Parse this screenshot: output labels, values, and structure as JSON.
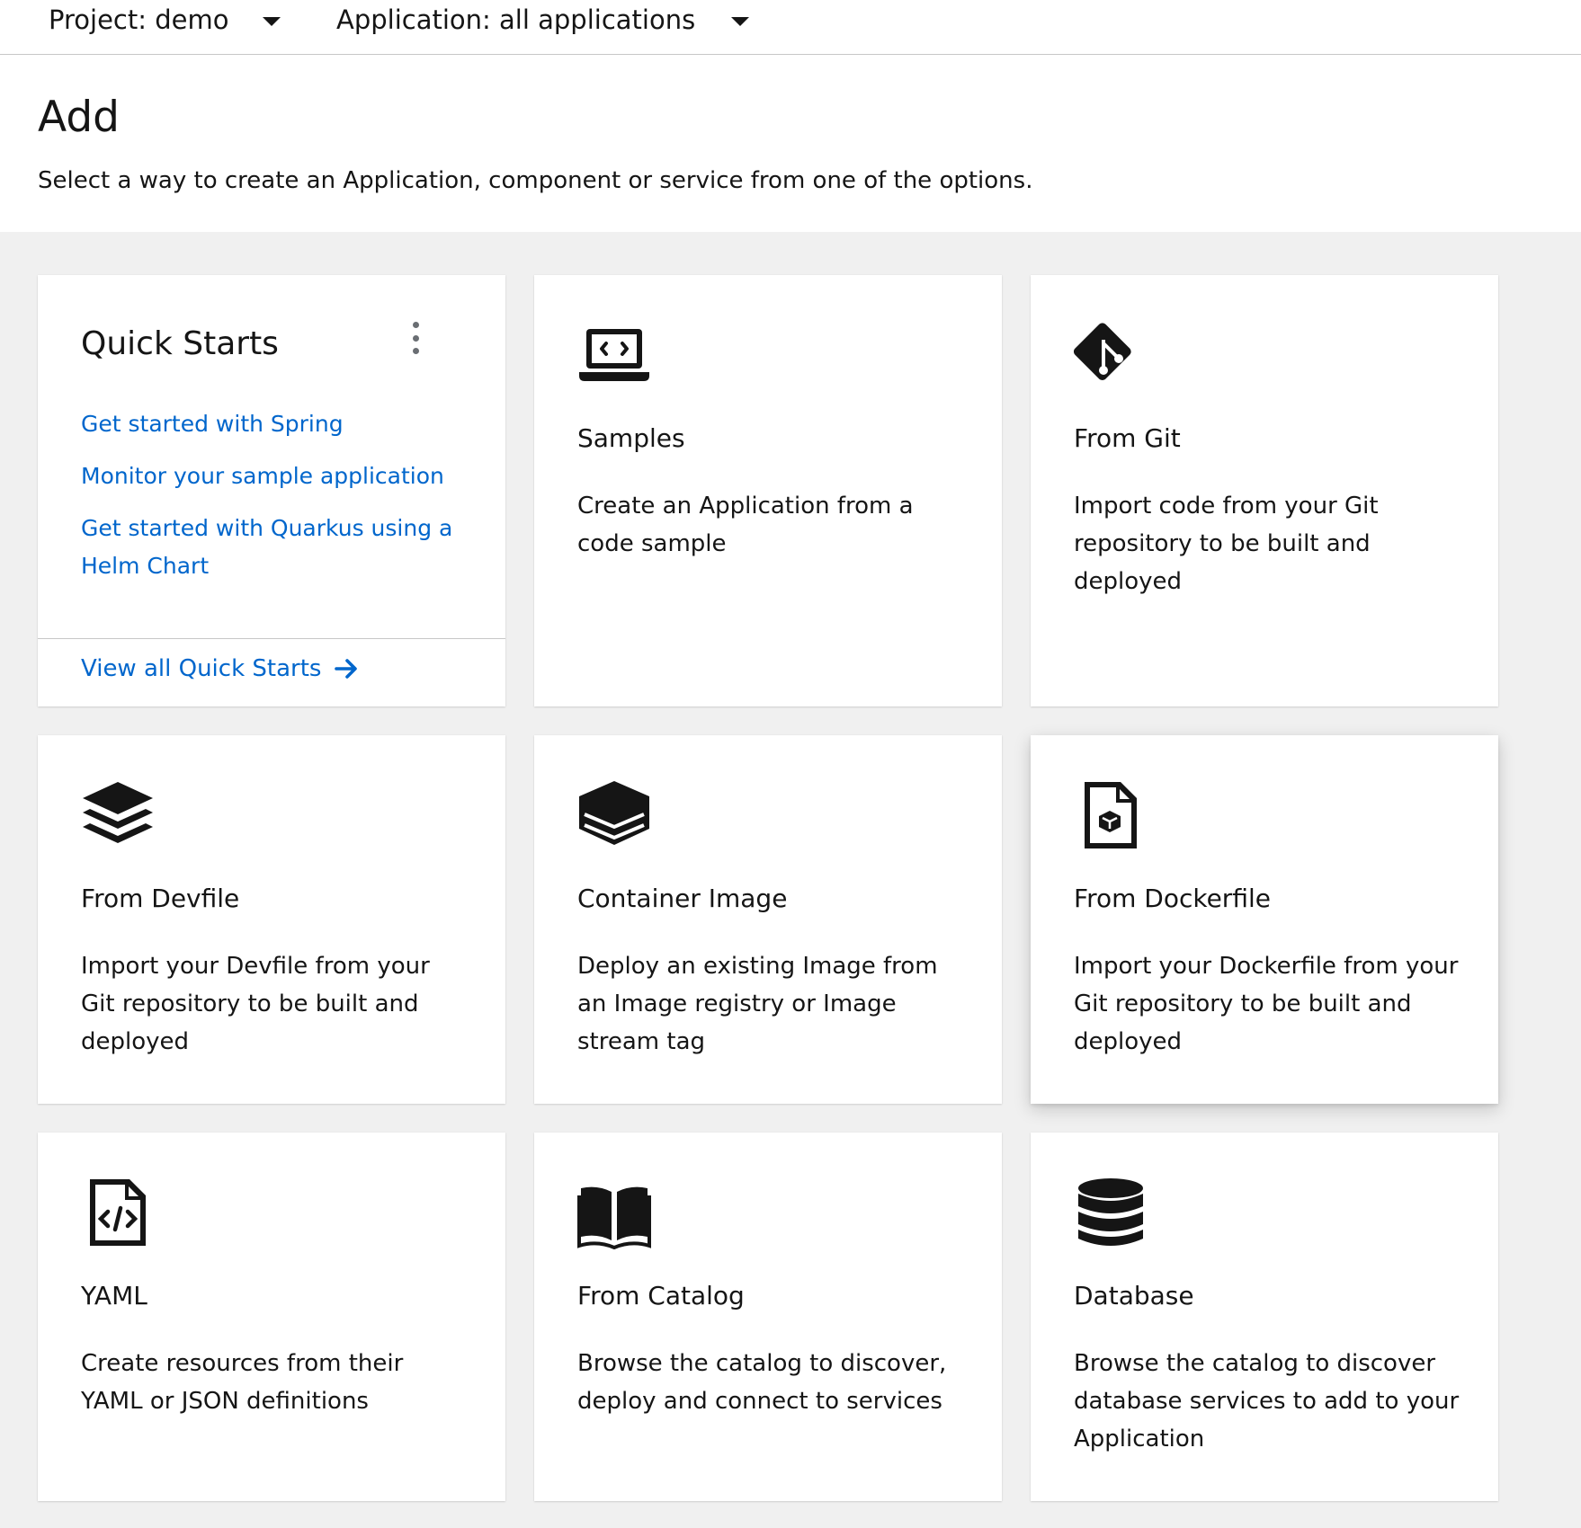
{
  "context_bar": {
    "project_label": "Project: demo",
    "application_label": "Application: all applications"
  },
  "page": {
    "title": "Add",
    "description": "Select a way to create an Application, component or service from one of the options."
  },
  "quick_starts": {
    "title": "Quick Starts",
    "links": [
      {
        "label": "Get started with Spring"
      },
      {
        "label": "Monitor your sample application"
      },
      {
        "label": "Get started with Quarkus using a Helm Chart"
      }
    ],
    "view_all_label": "View all Quick Starts"
  },
  "cards": {
    "samples": {
      "title": "Samples",
      "description": "Create an Application from a code sample",
      "icon": "laptop-code-icon"
    },
    "git": {
      "title": "From Git",
      "description": "Import code from your Git repository to be built and deployed",
      "icon": "git-icon"
    },
    "devfile": {
      "title": "From Devfile",
      "description": "Import your Devfile from your Git repository to be built and deployed",
      "icon": "layers-icon"
    },
    "container": {
      "title": "Container Image",
      "description": "Deploy an existing Image from an Image registry or Image stream tag",
      "icon": "container-image-icon"
    },
    "dockerfile": {
      "title": "From Dockerfile",
      "description": "Import your Dockerfile from your Git repository to be built and deployed",
      "icon": "dockerfile-icon"
    },
    "yaml": {
      "title": "YAML",
      "description": "Create resources from their YAML or JSON definitions",
      "icon": "file-code-icon"
    },
    "catalog": {
      "title": "From Catalog",
      "description": "Browse the catalog to discover, deploy and connect to services",
      "icon": "book-icon"
    },
    "database": {
      "title": "Database",
      "description": "Browse the catalog to discover database services to add to your Application",
      "icon": "database-icon"
    }
  },
  "colors": {
    "link": "#0066cc",
    "text": "#151515",
    "background_grey": "#f0f0f0"
  }
}
